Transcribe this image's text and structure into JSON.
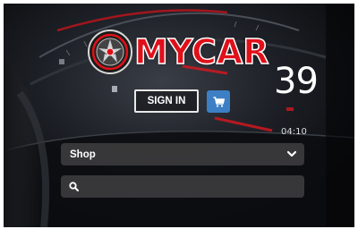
{
  "brand": {
    "name": "MYCAR"
  },
  "dashboard": {
    "speed": "39",
    "clock": "04:10"
  },
  "header": {
    "signin_label": "SIGN IN",
    "cart_icon": "cart-icon"
  },
  "shop": {
    "selected": "Shop"
  },
  "search": {
    "placeholder": "",
    "value": ""
  },
  "colors": {
    "brand_red": "#e0101a",
    "cart_blue": "#3d7fc4",
    "field_bg": "#3e3c3e"
  }
}
